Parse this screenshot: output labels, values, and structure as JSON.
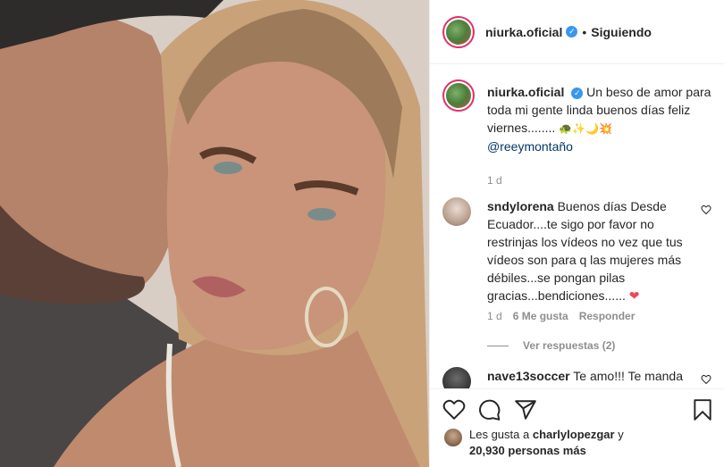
{
  "post": {
    "username": "niurka.oficial",
    "follow_status": "Siguiendo",
    "separator": "•"
  },
  "caption": {
    "username": "niurka.oficial",
    "text": "Un beso de amor para toda mi gente linda buenos días feliz viernes........",
    "emojis": "🐢✨🌙💥",
    "mention": "@reeymontaño",
    "time": "1 d"
  },
  "comments": [
    {
      "username": "sndylorena",
      "text": "Buenos días Desde Ecuador....te sigo por favor no restrinjas los vídeos no vez que tus vídeos son para q las mujeres más débiles...se pongan pilas gracias...bendiciones......",
      "emoji": "❤",
      "time": "1 d",
      "likes": "6 Me gusta",
      "reply_label": "Responder",
      "view_replies": "Ver respuestas (2)"
    },
    {
      "username": "nave13soccer",
      "text": "Te amo!!! Te manda"
    }
  ],
  "likes": {
    "prefix": "Les gusta a",
    "user": "charlylopezgar",
    "conj": "y",
    "others": "20,930 personas más"
  },
  "icons": [
    "heart-icon",
    "comment-icon",
    "share-icon",
    "bookmark-icon",
    "verified-icon"
  ],
  "colors": {
    "verified": "#3897f0",
    "link": "#00376b",
    "muted": "#8e8e8e",
    "heart_red": "#ed4956"
  }
}
